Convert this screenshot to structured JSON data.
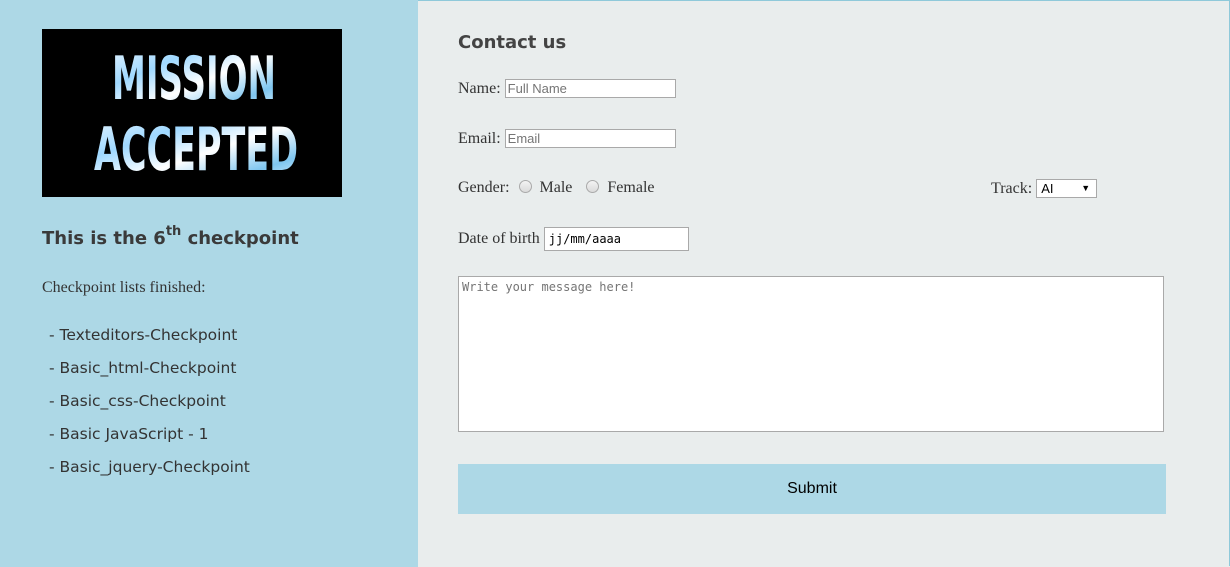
{
  "sidebar": {
    "logo_text": {
      "line1": "MISSION",
      "line2": "ACCEPTED"
    },
    "checkpoint_title": {
      "prefix": "This is the 6",
      "superscript": "th",
      "suffix": " checkpoint"
    },
    "subtitle": "Checkpoint lists finished:",
    "items": [
      "- Texteditors-Checkpoint",
      "- Basic_html-Checkpoint",
      "- Basic_css-Checkpoint",
      "- Basic JavaScript - 1",
      "- Basic_jquery-Checkpoint"
    ]
  },
  "form": {
    "title": "Contact us",
    "name": {
      "label": "Name:",
      "placeholder": "Full Name",
      "value": ""
    },
    "email": {
      "label": "Email:",
      "placeholder": "Email",
      "value": ""
    },
    "gender": {
      "label": "Gender:",
      "options": [
        "Male",
        "Female"
      ],
      "selected": null
    },
    "track": {
      "label": "Track:",
      "selected": "AI"
    },
    "dob": {
      "label": "Date of birth",
      "value": "jj/mm/aaaa"
    },
    "message": {
      "placeholder": "Write your message here!",
      "value": ""
    },
    "submit_label": "Submit"
  },
  "icons": {
    "dropdown": "dropdown-arrow-icon"
  },
  "colors": {
    "sidebar_bg": "#add8e6",
    "main_bg": "#e9eded",
    "submit_bg": "#add8e6"
  }
}
